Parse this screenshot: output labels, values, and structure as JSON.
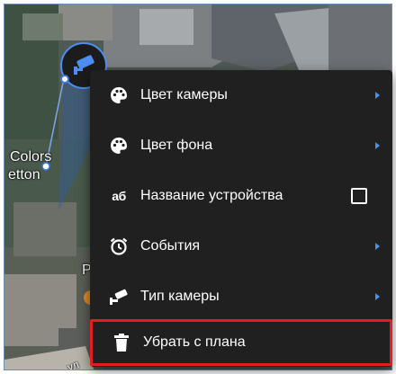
{
  "map": {
    "labels": [
      "Colors",
      "etton",
      "Р",
      "ул"
    ]
  },
  "colors": {
    "menu_background": "#202020",
    "chevron": "#4d8ef0",
    "highlight_border": "#e02020",
    "marker_ring": "#4d8ef0"
  },
  "context_menu": {
    "items": [
      {
        "label": "Цвет камеры",
        "icon": "palette-icon",
        "submenu": true
      },
      {
        "label": "Цвет фона",
        "icon": "palette-icon",
        "submenu": true
      },
      {
        "label": "Название устройства",
        "icon": "text-ab-icon",
        "icon_text": "аб",
        "checkbox": false
      },
      {
        "label": "События",
        "icon": "alarm-clock-icon",
        "submenu": true
      },
      {
        "label": "Тип камеры",
        "icon": "security-camera-icon",
        "submenu": true
      },
      {
        "label": "Убрать с плана",
        "icon": "trash-icon",
        "highlighted": true
      }
    ]
  }
}
